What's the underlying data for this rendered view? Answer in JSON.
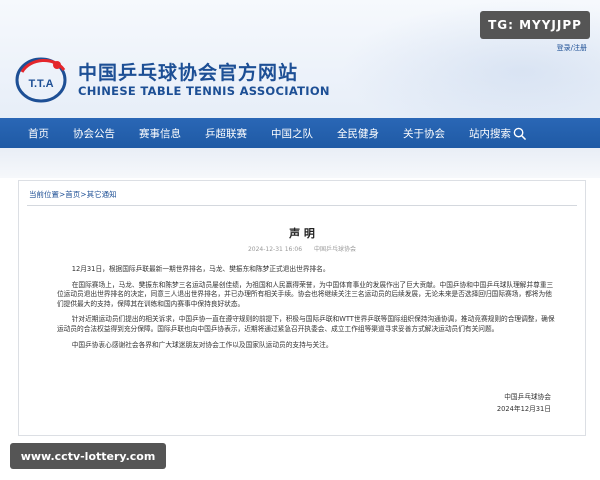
{
  "watermark_top": "TG: MYYJJPP",
  "header": {
    "login_link": "登录/注册",
    "site_title": "中国乒乓球协会官方网站",
    "site_subtitle": "CHINESE TABLE TENNIS ASSOCIATION",
    "logo_icon": "ctta-logo-icon",
    "logo_text": "T.T.A"
  },
  "nav": {
    "items": [
      "首页",
      "协会公告",
      "赛事信息",
      "乒超联赛",
      "中国之队",
      "全民健身",
      "关于协会",
      "站内搜索"
    ],
    "search_icon": "search-icon"
  },
  "breadcrumb": {
    "prefix": "当前位置>",
    "home": "首页",
    "sep": ">",
    "current": "其它通知"
  },
  "article": {
    "title": "声 明",
    "date": "2024-12-31 16:06",
    "source": "中国乒乓球协会",
    "paragraphs": [
      "12月31日，根据国际乒联最新一期世界排名，马龙、樊振东和陈梦正式退出世界排名。",
      "在国际赛场上，马龙、樊振东和陈梦三名运动员屡创佳绩，为祖国和人民赢得荣誉，为中国体育事业的发展作出了巨大贡献。中国乒协和中国乒乓球队理解并尊重三位运动员退出世界排名的决定，同意三人退出世界排名，并已办理所有相关手续。协会也将继续关注三名运动员的后续发展，无论未来是否选择回归国际赛场，都将为他们提供最大的支持，保障其在训练和国内赛事中保持良好状态。",
      "针对近期运动员们提出的相关诉求，中国乒协一直在遵守规则的前提下，积极与国际乒联和WTT世界乒联等国际组织保持沟通协调，推动竞赛规则的合理调整，确保运动员的合法权益得到充分保障。国际乒联也向中国乒协表示，近期将通过紧急召开执委会、成立工作组等渠道寻求妥善方式解决运动员们有关问题。",
      "中国乒协衷心感谢社会各界和广大球迷朋友对协会工作以及国家队运动员的支持与关注。"
    ],
    "sign_org": "中国乒乓球协会",
    "sign_date": "2024年12月31日"
  },
  "watermark_bottom": "www.cctv-lottery.com",
  "colors": {
    "brand_blue": "#1d4f95",
    "nav_blue": "#2565b2",
    "watermark_gray": "#555555"
  }
}
